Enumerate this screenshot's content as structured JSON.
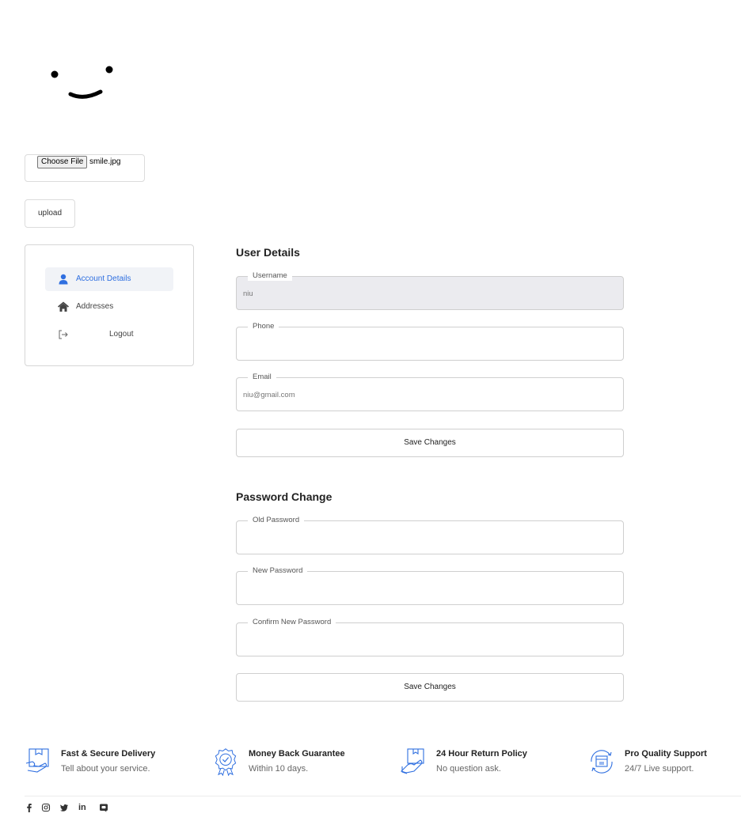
{
  "upload": {
    "choose_label": "Choose File",
    "file_name": "smile.jpg",
    "upload_label": "upload"
  },
  "sidebar": {
    "items": [
      {
        "label": "Account Details",
        "icon": "user-icon",
        "active": true
      },
      {
        "label": "Addresses",
        "icon": "home-icon",
        "active": false
      },
      {
        "label": "Logout",
        "icon": "logout-icon",
        "active": false
      }
    ]
  },
  "user_details": {
    "title": "User Details",
    "username_label": "Username",
    "username_value": "niu",
    "phone_label": "Phone",
    "phone_value": "",
    "email_label": "Email",
    "email_value": "niu@gmail.com",
    "save_label": "Save Changes"
  },
  "password_change": {
    "title": "Password Change",
    "old_label": "Old Password",
    "new_label": "New Password",
    "confirm_label": "Confirm New Password",
    "save_label": "Save Changes"
  },
  "features": [
    {
      "title": "Fast & Secure Delivery",
      "subtitle": "Tell about your service.",
      "icon": "delivery-box-icon"
    },
    {
      "title": "Money Back Guarantee",
      "subtitle": "Within 10 days.",
      "icon": "badge-check-icon"
    },
    {
      "title": "24 Hour Return Policy",
      "subtitle": "No question ask.",
      "icon": "return-box-icon"
    },
    {
      "title": "Pro Quality Support",
      "subtitle": "24/7 Live support.",
      "icon": "support-icon"
    }
  ],
  "socials": [
    "facebook-icon",
    "instagram-icon",
    "twitter-icon",
    "linkedin-icon",
    "discord-icon"
  ],
  "colors": {
    "accent": "#2f6fe0",
    "border": "#cfcfcf",
    "disabled_bg": "#ebebef"
  }
}
